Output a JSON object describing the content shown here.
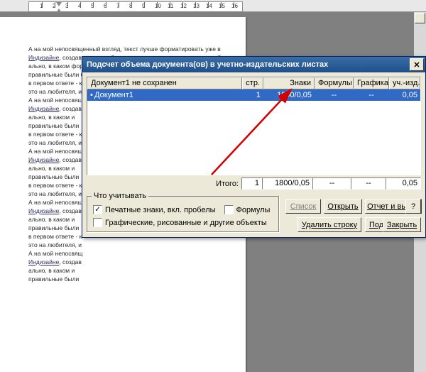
{
  "ruler": {
    "numbers": [
      1,
      2,
      3,
      4,
      5,
      6,
      7,
      8,
      9,
      10,
      11,
      12,
      13,
      14,
      15,
      16
    ]
  },
  "document": {
    "lines": [
      "А на мой непосвященный взгляд, текст лучше форматировать уже в",
      "Индизайне, создавая стили абзацев и символов, применяемые глоб-",
      "ально, в каком формате документа вы работаете. Поэтому все",
      "правильные были бы",
      "в первом ответе - к",
      "это на любителя, и",
      "А на мой непосвящ",
      "Индизайне, создав",
      "ально, в каком и",
      "правильные были",
      "в первом ответе - к",
      "это на любителя, и",
      "А на мой непосвящ",
      "Индизайне, создав",
      "ально, в каком и",
      "правильные были",
      "в первом ответе - к",
      "это на любителя, и",
      "А на мой непосвящ",
      "Индизайне, создав",
      "ально, в каком и",
      "правильные были",
      "в первом ответе - к",
      "это на любителя, и",
      "А на мой непосвящ",
      "Индизайне, создав",
      "ально, в каком и",
      "правильные были"
    ]
  },
  "dialog": {
    "title": "Подсчет объема документа(ов) в учетно-издательских листах",
    "columns": {
      "name": "Документ1 не сохранен",
      "pages": "стр.",
      "chars": "Знаки",
      "formulas": "Формулы",
      "graphics": "Графика",
      "sheets": "уч.-изд.л."
    },
    "rows": [
      {
        "name": "Документ1",
        "pages": "1",
        "chars": "1800/0,05",
        "formulas": "--",
        "graphics": "--",
        "sheets": "0,05"
      }
    ],
    "totals": {
      "label": "Итого:",
      "pages": "1",
      "chars": "1800/0,05",
      "formulas": "--",
      "graphics": "--",
      "sheets": "0,05"
    },
    "group": {
      "legend": "Что учитывать",
      "chk_print": "Печатные знаки, вкл. пробелы",
      "chk_formulas": "Формулы",
      "chk_graphics": "Графические, рисованные и другие объекты",
      "checked_print": "✓",
      "checked_formulas": "",
      "checked_graphics": ""
    },
    "buttons": {
      "list": "Список",
      "open": "Открыть",
      "report": "Отчет и выход",
      "help": "?",
      "delrow": "Удалить строку",
      "calc": "Подсчет",
      "close": "Закрыть"
    }
  }
}
